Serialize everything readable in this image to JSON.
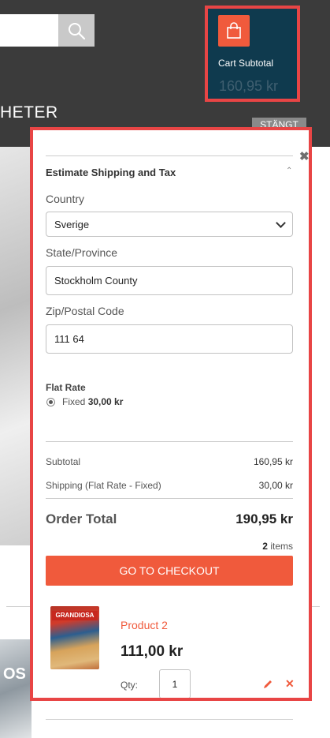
{
  "header": {
    "search_placeholder": "",
    "nav_text": "HETER",
    "closed_badge": "STÄNGT",
    "cart": {
      "label": "Cart Subtotal",
      "amount": "160,95 kr"
    }
  },
  "background": {
    "logo_fragment": "OS"
  },
  "minicart": {
    "close_glyph": "✖",
    "estimate": {
      "title": "Estimate Shipping and Tax",
      "country_label": "Country",
      "country_value": "Sverige",
      "state_label": "State/Province",
      "state_value": "Stockholm County",
      "zip_label": "Zip/Postal Code",
      "zip_value": "111 64"
    },
    "shipping_method": {
      "title": "Flat Rate",
      "option_prefix": "Fixed",
      "option_price": "30,00 kr"
    },
    "totals": {
      "subtotal_label": "Subtotal",
      "subtotal_value": "160,95 kr",
      "shipping_label": "Shipping (Flat Rate - Fixed)",
      "shipping_value": "30,00 kr",
      "order_total_label": "Order Total",
      "order_total_value": "190,95 kr"
    },
    "items_count": "2",
    "items_word": "items",
    "checkout_label": "GO TO CHECKOUT",
    "product": {
      "brand": "GRANDIOSA",
      "name": "Product 2",
      "price": "111,00 kr",
      "qty_label": "Qty:",
      "qty_value": "1"
    }
  },
  "colors": {
    "accent": "#f05a3c",
    "highlight_border": "#e84545",
    "cart_bg": "#0f3a4e",
    "header_bg": "#3b3b3b"
  }
}
